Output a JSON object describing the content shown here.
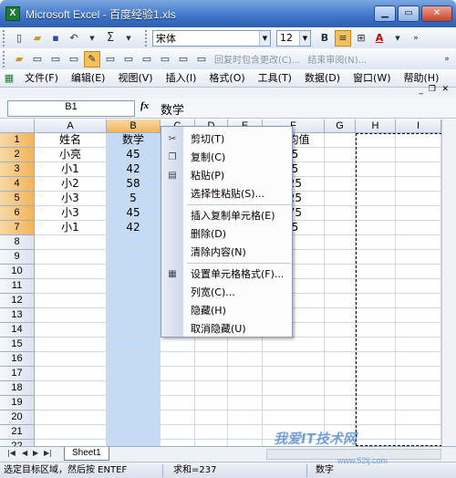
{
  "window": {
    "title": "Microsoft Excel - 百度经验1.xls",
    "app_icon": "X"
  },
  "toolbar1": {
    "sigma": "Σ",
    "font_name": "宋体",
    "font_size": "12",
    "bold": "B",
    "italic": "I",
    "underline": "U",
    "font_color_letter": "A"
  },
  "toolbar2": {
    "reply_label": "回复时包含更改(C)...",
    "end_review_label": "结束审阅(N)..."
  },
  "menu": {
    "items": [
      "文件(F)",
      "编辑(E)",
      "视图(V)",
      "插入(I)",
      "格式(O)",
      "工具(T)",
      "数据(D)",
      "窗口(W)",
      "帮助(H)"
    ]
  },
  "formula_bar": {
    "name_box": "B1",
    "fx": "fx",
    "content": "数学"
  },
  "sheet": {
    "columns": [
      "A",
      "B",
      "C",
      "D",
      "E",
      "F",
      "G",
      "H",
      "I"
    ],
    "rows": [
      "1",
      "2",
      "3",
      "4",
      "5",
      "6",
      "7",
      "8",
      "9",
      "10",
      "11",
      "12",
      "13",
      "14",
      "15",
      "16",
      "17",
      "18",
      "19",
      "20",
      "21",
      "22"
    ],
    "colA": [
      "姓名",
      "小亮",
      "小1",
      "小2",
      "小3",
      "小3",
      "小1"
    ],
    "colB": [
      "数学",
      "45",
      "42",
      "58",
      "5",
      "45",
      "42"
    ],
    "colF": [
      "平均值",
      ".5",
      ".5",
      ".25",
      ".25",
      ".75",
      ".5"
    ]
  },
  "context_menu": {
    "items": [
      {
        "label": "剪切(T)",
        "icon": "scissors-icon",
        "glyph": "✂"
      },
      {
        "label": "复制(C)",
        "icon": "copy-icon",
        "glyph": "❐"
      },
      {
        "label": "粘贴(P)",
        "icon": "paste-icon",
        "glyph": "▤"
      },
      {
        "label": "选择性粘贴(S)...",
        "icon": "",
        "glyph": ""
      },
      {
        "label": "插入复制单元格(E)",
        "icon": "",
        "glyph": ""
      },
      {
        "label": "删除(D)",
        "icon": "",
        "glyph": ""
      },
      {
        "label": "清除内容(N)",
        "icon": "",
        "glyph": ""
      },
      {
        "label": "设置单元格格式(F)...",
        "icon": "format-cells-icon",
        "glyph": "▦"
      },
      {
        "label": "列宽(C)...",
        "icon": "",
        "glyph": ""
      },
      {
        "label": "隐藏(H)",
        "icon": "",
        "glyph": ""
      },
      {
        "label": "取消隐藏(U)",
        "icon": "",
        "glyph": ""
      }
    ]
  },
  "sheet_tabs": {
    "active": "Sheet1"
  },
  "status": {
    "message": "选定目标区域，然后按 ENTEF",
    "sum": "求和=237",
    "mode": "数字"
  },
  "watermark": {
    "text": "我爱IT技术网",
    "url": "www.52ij.com"
  }
}
